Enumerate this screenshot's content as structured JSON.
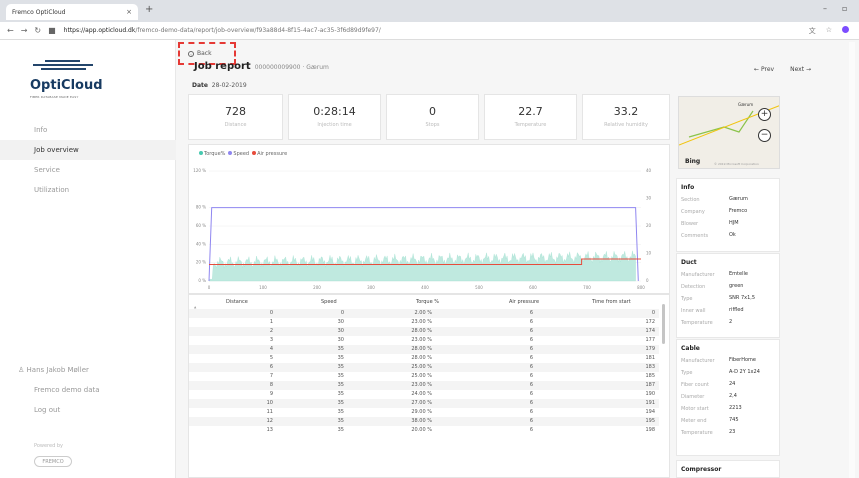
{
  "browser": {
    "tab_title": "Fremco OptiCloud",
    "tab_close": "×",
    "new_tab": "+",
    "url_host": "https://app.opticloud.dk",
    "url_path": "/fremco-demo-data/report/job-overview/f93a88d4-8f15-4ac7-ac35-3f6d89d9fe97/",
    "minimize": "–",
    "maximize": "▫"
  },
  "sidebar": {
    "logo_text": "OptiCloud",
    "logo_sub": "FIBER DATABASE MADE EASY",
    "items": [
      {
        "label": "Info"
      },
      {
        "label": "Job overview"
      },
      {
        "label": "Service"
      },
      {
        "label": "Utilization"
      }
    ],
    "user": "Hans Jakob Møller",
    "org": "Fremco demo data",
    "logout": "Log out",
    "powered": "Powered by",
    "brand": "FREMCO"
  },
  "header": {
    "back": "Back",
    "title": "Job report",
    "job_id": "000000009900 · Gærum",
    "date_label": "Date",
    "date": "28-02-2019",
    "prev": "← Prev",
    "next": "Next →"
  },
  "stats": [
    {
      "value": "728",
      "label": "Distance"
    },
    {
      "value": "0:28:14",
      "label": "Injection time"
    },
    {
      "value": "0",
      "label": "Stops"
    },
    {
      "value": "22.7",
      "label": "Temperature"
    },
    {
      "value": "33.2",
      "label": "Relative humidity"
    }
  ],
  "map": {
    "bing": "Bing",
    "copyright": "© 2019 Microsoft Corporation",
    "label": "Gærum"
  },
  "chart_data": {
    "type": "line",
    "legend": [
      "Torque%",
      "Speed",
      "Air pressure"
    ],
    "colors": {
      "torque": "#48c9b0",
      "speed": "#8f86f0",
      "air": "#e74c3c"
    },
    "y_left_ticks": [
      "120 %",
      "80 %",
      "60 %",
      "40 %",
      "20 %",
      "0 %"
    ],
    "y_right_ticks": [
      "40",
      "30",
      "20",
      "10",
      "0"
    ],
    "x_ticks": [
      "0",
      "100",
      "200",
      "300",
      "400",
      "500",
      "600",
      "700",
      "800"
    ],
    "xlim": [
      0,
      800
    ],
    "ylim": [
      0,
      120
    ],
    "series": [
      {
        "name": "Speed",
        "values": [
          [
            0,
            0
          ],
          [
            5,
            80
          ],
          [
            790,
            80
          ],
          [
            795,
            0
          ]
        ]
      },
      {
        "name": "Air pressure",
        "values": [
          [
            0,
            6
          ],
          [
            690,
            6
          ],
          [
            690,
            8
          ],
          [
            800,
            8
          ]
        ]
      },
      {
        "name": "Torque%",
        "values": [
          [
            0,
            2
          ],
          [
            50,
            23
          ],
          [
            100,
            25
          ],
          [
            200,
            29
          ],
          [
            300,
            25
          ],
          [
            400,
            28
          ],
          [
            500,
            30
          ],
          [
            600,
            32
          ],
          [
            700,
            30
          ],
          [
            790,
            32
          ],
          [
            795,
            0
          ]
        ]
      }
    ]
  },
  "table": {
    "headers": [
      "Distance",
      "Speed",
      "Torque %",
      "Air pressure",
      "Time from start"
    ],
    "rows": [
      [
        "0",
        "0",
        "2.00 %",
        "6",
        "0"
      ],
      [
        "1",
        "30",
        "23.00 %",
        "6",
        "172"
      ],
      [
        "2",
        "30",
        "28.00 %",
        "6",
        "174"
      ],
      [
        "3",
        "30",
        "23.00 %",
        "6",
        "177"
      ],
      [
        "4",
        "35",
        "28.00 %",
        "6",
        "179"
      ],
      [
        "5",
        "35",
        "28.00 %",
        "6",
        "181"
      ],
      [
        "6",
        "35",
        "25.00 %",
        "6",
        "183"
      ],
      [
        "7",
        "35",
        "25.00 %",
        "6",
        "185"
      ],
      [
        "8",
        "35",
        "23.00 %",
        "6",
        "187"
      ],
      [
        "9",
        "35",
        "24.00 %",
        "6",
        "190"
      ],
      [
        "10",
        "35",
        "27.00 %",
        "6",
        "191"
      ],
      [
        "11",
        "35",
        "29.00 %",
        "6",
        "194"
      ],
      [
        "12",
        "35",
        "38.00 %",
        "6",
        "195"
      ],
      [
        "13",
        "35",
        "20.00 %",
        "6",
        "198"
      ]
    ]
  },
  "info": {
    "title": "Info",
    "items": [
      [
        "Section",
        "Gærum"
      ],
      [
        "Company",
        "Fremco"
      ],
      [
        "Blower",
        "HJM"
      ],
      [
        "Comments",
        "Ok"
      ]
    ]
  },
  "duct": {
    "title": "Duct",
    "items": [
      [
        "Manufacturer",
        "Emtelle"
      ],
      [
        "Detection",
        "green"
      ],
      [
        "Type",
        "SNR 7x1,5"
      ],
      [
        "Inner wall",
        "riffled"
      ],
      [
        "Temperature",
        "2"
      ]
    ]
  },
  "cable": {
    "title": "Cable",
    "items": [
      [
        "Manufacturer",
        "FiberHome"
      ],
      [
        "Type",
        "A-D 2Y 1x24"
      ],
      [
        "Fiber count",
        "24"
      ],
      [
        "Diameter",
        "2,4"
      ],
      [
        "Motor start",
        "2213"
      ],
      [
        "Meter end",
        "745"
      ],
      [
        "Temperature",
        "23"
      ]
    ]
  },
  "compressor": {
    "title": "Compressor"
  }
}
